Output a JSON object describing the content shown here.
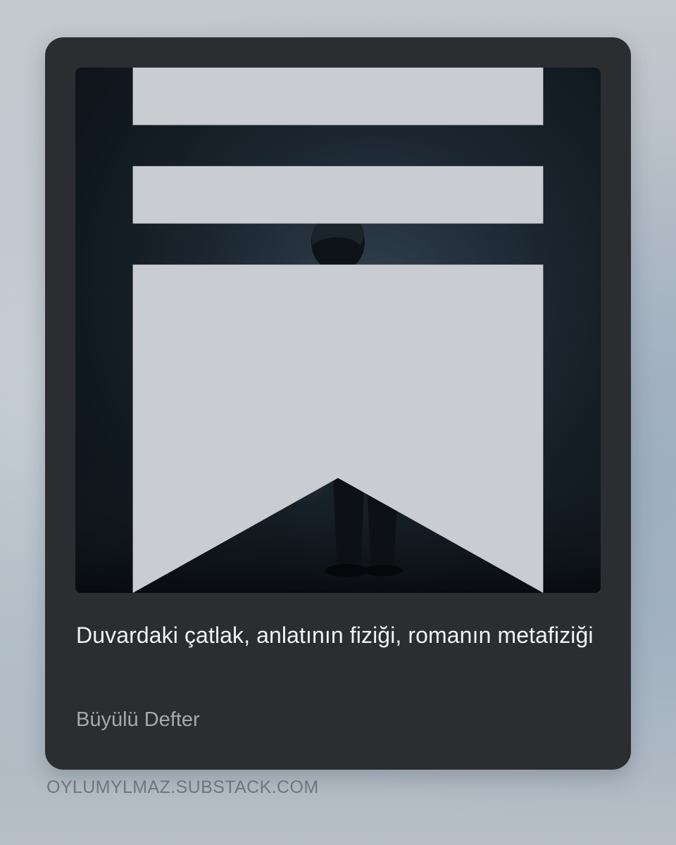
{
  "post": {
    "title": "Duvardaki çatlak, anlatının fiziği, romanın metafiziği",
    "publication": "Büyülü Defter",
    "cover_image": {
      "description_icon": "cover-image",
      "overlay_icon": "substack-bookmark-icon"
    }
  },
  "footer": {
    "url": "OYLUMYLMAZ.SUBSTACK.COM"
  },
  "colors": {
    "card_background": "#2b2d31",
    "title_text": "#f2f3f5",
    "publication_text": "#a6a8ad",
    "footer_text": "#6d7680"
  }
}
